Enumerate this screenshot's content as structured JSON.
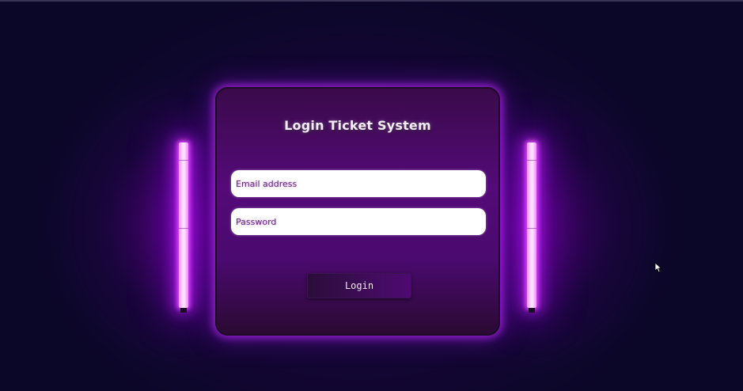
{
  "colors": {
    "background": "#0b0728",
    "card": "#540a78",
    "glow": "#c81eff",
    "tube_core": "#ffe8ff",
    "input_background": "#ffffff",
    "placeholder_text": "#6a2a80",
    "button": "#3a0d52",
    "title_text": "#f4ecf8"
  },
  "login": {
    "title": "Login Ticket System",
    "email": {
      "value": "",
      "placeholder": "Email address"
    },
    "password": {
      "value": "",
      "placeholder": "Password"
    },
    "submit_label": "Login"
  },
  "decor": {
    "left_light": "neon-tube",
    "right_light": "neon-tube"
  },
  "pointer": "arrow-cursor-icon"
}
